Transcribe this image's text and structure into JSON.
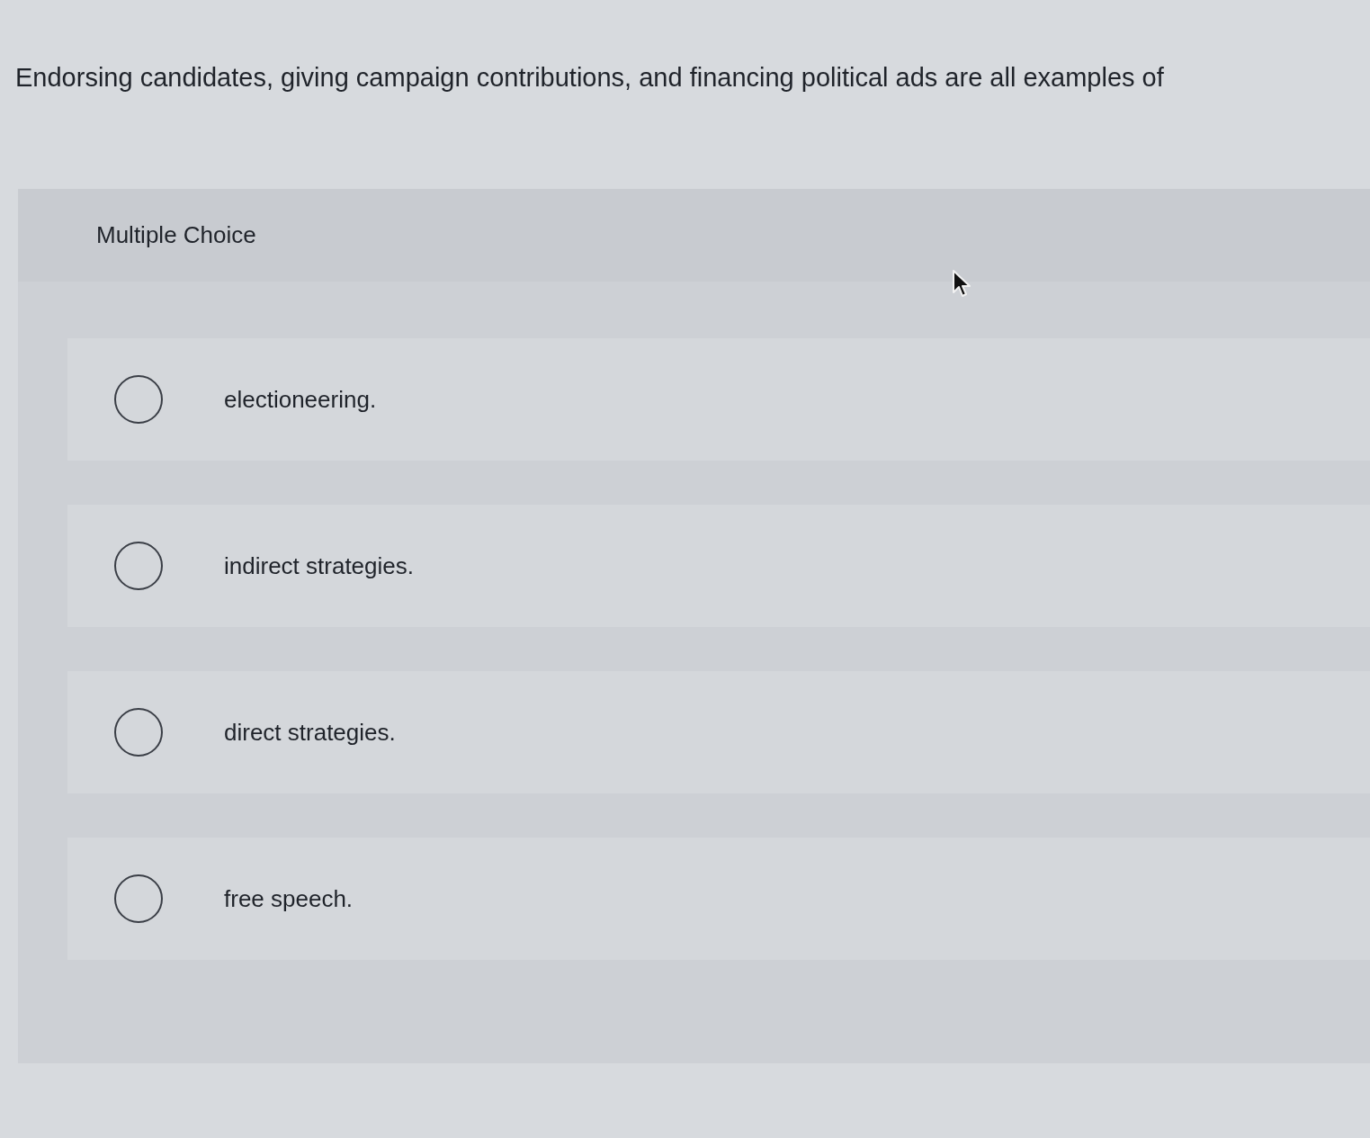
{
  "question": {
    "text": "Endorsing candidates, giving campaign contributions, and financing political ads are all examples of"
  },
  "panel": {
    "title": "Multiple Choice",
    "options": [
      {
        "label": "electioneering.",
        "selected": false
      },
      {
        "label": "indirect strategies.",
        "selected": false
      },
      {
        "label": "direct strategies.",
        "selected": false
      },
      {
        "label": "free speech.",
        "selected": false
      }
    ]
  }
}
